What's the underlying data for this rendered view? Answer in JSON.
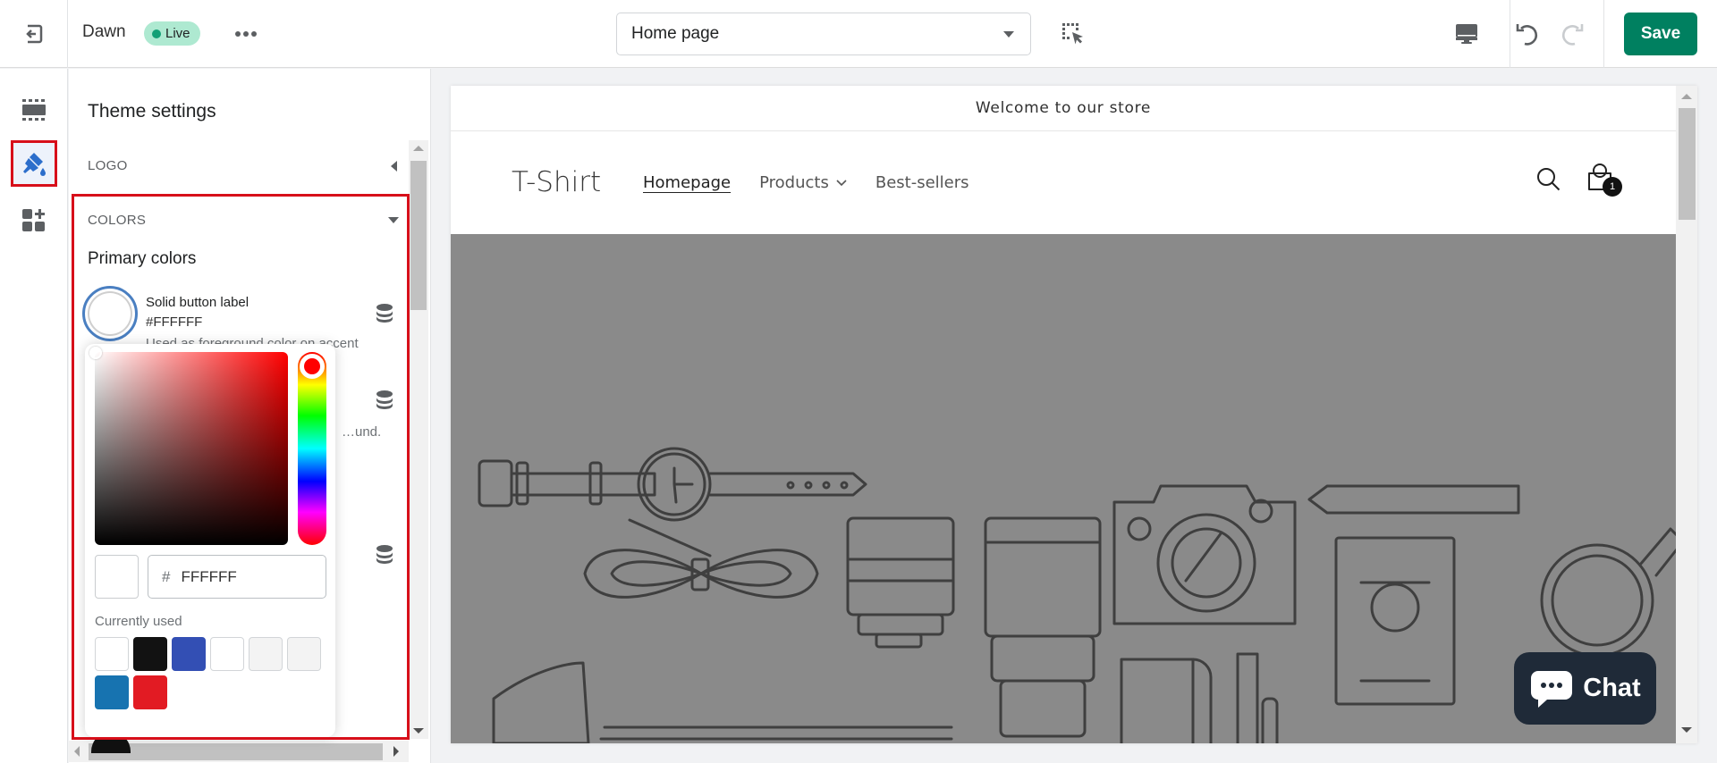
{
  "topbar": {
    "exit_icon": "exit-icon",
    "theme_name": "Dawn",
    "status_badge": "Live",
    "more_icon": "more-horizontal-icon",
    "page_select": {
      "selected": "Home page"
    },
    "inspector_icon": "select-element-icon",
    "device_icon": "desktop-icon",
    "undo_icon": "undo-icon",
    "redo_icon": "redo-icon",
    "save_label": "Save",
    "colors": {
      "save": "#008060",
      "live_badge": "#aee9d1",
      "live_dot": "#13a076"
    }
  },
  "rail": {
    "items": [
      {
        "name": "sections",
        "icon": "sections-icon",
        "active": false
      },
      {
        "name": "theme-settings",
        "icon": "paint-brush-icon",
        "active": true
      },
      {
        "name": "app-embeds",
        "icon": "apps-add-icon",
        "active": false
      }
    ]
  },
  "panel": {
    "title": "Theme settings",
    "sections": [
      {
        "label": "LOGO",
        "expanded": false
      },
      {
        "label": "COLORS",
        "expanded": true
      }
    ],
    "subheading": "Primary colors",
    "color_settings": [
      {
        "label": "Solid button label",
        "value": "#FFFFFF",
        "help": "Used as foreground color on accent"
      },
      {
        "label": "",
        "value": "",
        "help": "…und."
      },
      {
        "label": "",
        "value": "",
        "help": ""
      }
    ]
  },
  "color_picker": {
    "hex_prefix": "#",
    "hex_value": "FFFFFF",
    "hue": "#ff0000",
    "currently_used_label": "Currently used",
    "currently_used": [
      "#ffffff",
      "#121212",
      "#334fb4",
      "#ffffff",
      "#f3f3f3",
      "#f3f3f3",
      "#1773b0",
      "#e21b23"
    ]
  },
  "preview": {
    "announcement": "Welcome to our store",
    "store_logo": "T-Shirt",
    "nav": [
      {
        "label": "Homepage",
        "current": true,
        "dropdown": false
      },
      {
        "label": "Products",
        "current": false,
        "dropdown": true
      },
      {
        "label": "Best-sellers",
        "current": false,
        "dropdown": false
      }
    ],
    "search_icon": "search-icon",
    "cart_icon": "shopping-bag-icon",
    "cart_count": "1",
    "hero_illustration": "lifestyle-items-line-art"
  },
  "chat": {
    "label": "Chat",
    "icon": "chat-bubble-icon",
    "color": "#1f2a38"
  }
}
